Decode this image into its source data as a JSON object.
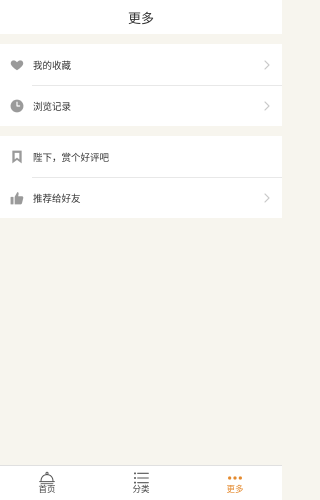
{
  "header": {
    "title": "更多"
  },
  "menu": {
    "group1": [
      {
        "label": "我的收藏",
        "icon": "heart-icon"
      },
      {
        "label": "浏览记录",
        "icon": "clock-icon"
      }
    ],
    "group2": [
      {
        "label": "陛下，赏个好评吧",
        "icon": "bookmark-icon"
      },
      {
        "label": "推荐给好友",
        "icon": "thumbs-up-icon"
      }
    ]
  },
  "tabbar": {
    "tabs": [
      {
        "label": "首页",
        "icon": "cloche-icon",
        "active": false
      },
      {
        "label": "分类",
        "icon": "list-icon",
        "active": false
      },
      {
        "label": "更多",
        "icon": "more-dots-icon",
        "active": true
      }
    ]
  },
  "colors": {
    "background": "#f7f5ee",
    "icon_gray": "#9a9a9a",
    "accent": "#e48a2e"
  }
}
